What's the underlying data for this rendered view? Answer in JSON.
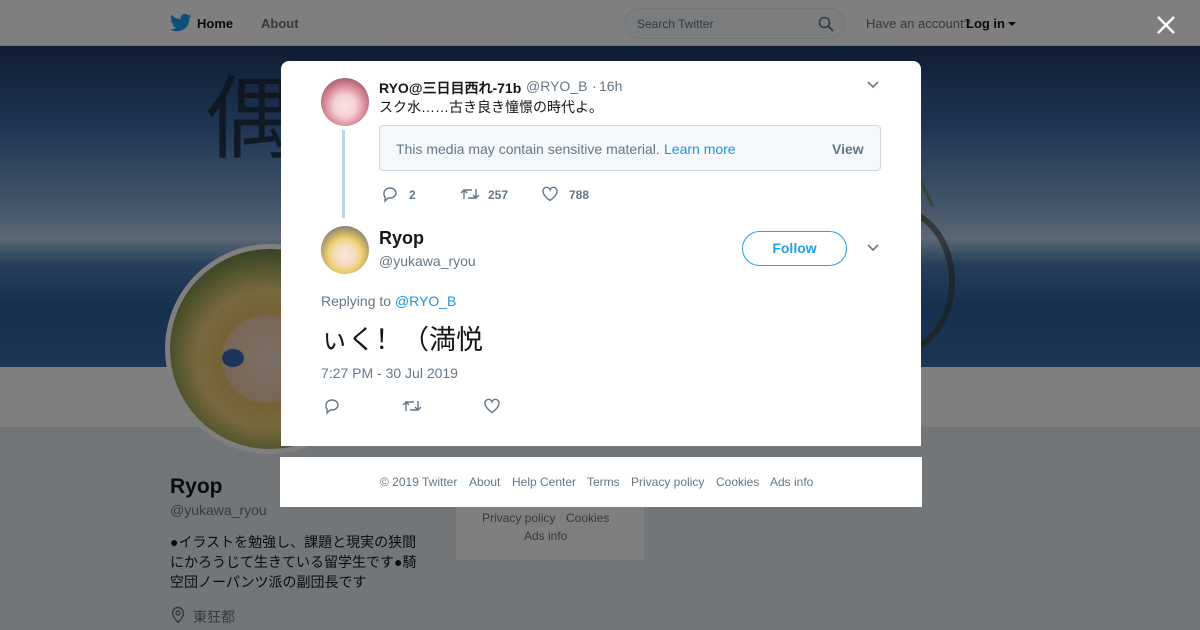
{
  "topbar": {
    "home_label": "Home",
    "about_label": "About",
    "search_placeholder": "Search Twitter",
    "have_account": "Have an account?",
    "login_label": "Log in"
  },
  "profile": {
    "name": "Ryop",
    "handle": "@yukawa_ryou",
    "bio": "●イラストを勉強し、課題と現実の狭間にかろうじて生きている留学生です●騎空団ノーパンツ派の副団長です",
    "location": "東狂都"
  },
  "side_footer": {
    "privacy": "Privacy policy",
    "cookies": "Cookies",
    "ads": "Ads info"
  },
  "parent_tweet": {
    "name": "RYO@三日目西れ-71b",
    "handle": "@RYO_B",
    "separator": "·",
    "time": "16h",
    "text": "スク水……古き良き憧憬の時代よ。",
    "sensitive_message": "This media may contain sensitive material.",
    "learn_more": "Learn more",
    "view_label": "View",
    "replies": "2",
    "retweets": "257",
    "likes": "788"
  },
  "main_tweet": {
    "name": "Ryop",
    "handle": "@yukawa_ryou",
    "follow_label": "Follow",
    "replying_prefix": "Replying to",
    "replying_to": "@RYO_B",
    "text": "ぃく！（満悦",
    "timestamp": "7:27 PM - 30 Jul 2019"
  },
  "footer": {
    "copyright": "© 2019 Twitter",
    "about": "About",
    "help": "Help Center",
    "terms": "Terms",
    "privacy": "Privacy policy",
    "cookies": "Cookies",
    "ads": "Ads info"
  },
  "colors": {
    "accent": "#1da1f2",
    "link": "#1b95e0",
    "muted": "#657786",
    "thread_line": "#b8d8f2"
  }
}
